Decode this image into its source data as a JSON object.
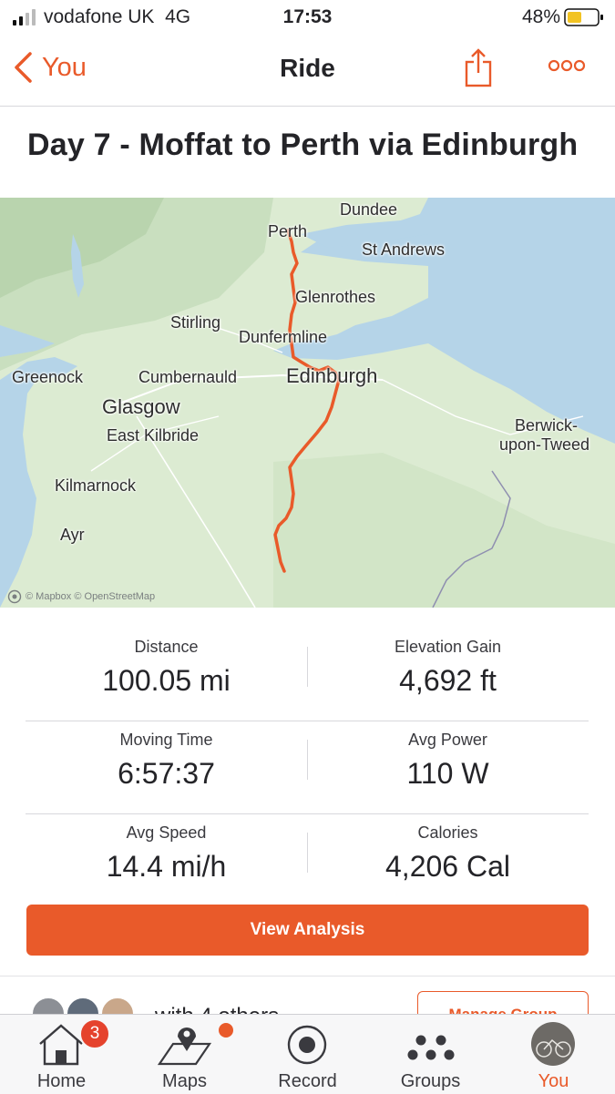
{
  "status_bar": {
    "carrier": "vodafone UK",
    "network": "4G",
    "time": "17:53",
    "battery": "48%"
  },
  "nav": {
    "back_label": "You",
    "title": "Ride"
  },
  "activity": {
    "title": "Day 7 - Moffat to Perth via Edinburgh"
  },
  "map": {
    "labels": {
      "dundee": "Dundee",
      "perth": "Perth",
      "st_andrews": "St Andrews",
      "glenrothes": "Glenrothes",
      "stirling": "Stirling",
      "dunfermline": "Dunfermline",
      "greenock": "Greenock",
      "cumbernauld": "Cumbernauld",
      "edinburgh": "Edinburgh",
      "glasgow": "Glasgow",
      "east_kilbride": "East Kilbride",
      "berwick_1": "Berwick-",
      "berwick_2": "upon-Tweed",
      "kilmarnock": "Kilmarnock",
      "ayr": "Ayr"
    },
    "attribution": "© Mapbox © OpenStreetMap",
    "route_color": "#e95a2a",
    "water_color": "#b5d4e8",
    "land_color": "#dcebd2"
  },
  "stats": [
    {
      "label": "Distance",
      "value": "100.05 mi"
    },
    {
      "label": "Elevation Gain",
      "value": "4,692 ft"
    },
    {
      "label": "Moving Time",
      "value": "6:57:37"
    },
    {
      "label": "Avg Power",
      "value": "110 W"
    },
    {
      "label": "Avg Speed",
      "value": "14.4 mi/h"
    },
    {
      "label": "Calories",
      "value": "4,206 Cal"
    }
  ],
  "view_analysis_label": "View Analysis",
  "group": {
    "with_text": "with 4 others",
    "manage_label": "Manage Group"
  },
  "tabbar": {
    "tabs": [
      {
        "label": "Home",
        "badge": "3"
      },
      {
        "label": "Maps"
      },
      {
        "label": "Record"
      },
      {
        "label": "Groups"
      },
      {
        "label": "You"
      }
    ],
    "active": "You"
  },
  "colors": {
    "accent": "#e95a2a",
    "badge": "#e5432d"
  }
}
